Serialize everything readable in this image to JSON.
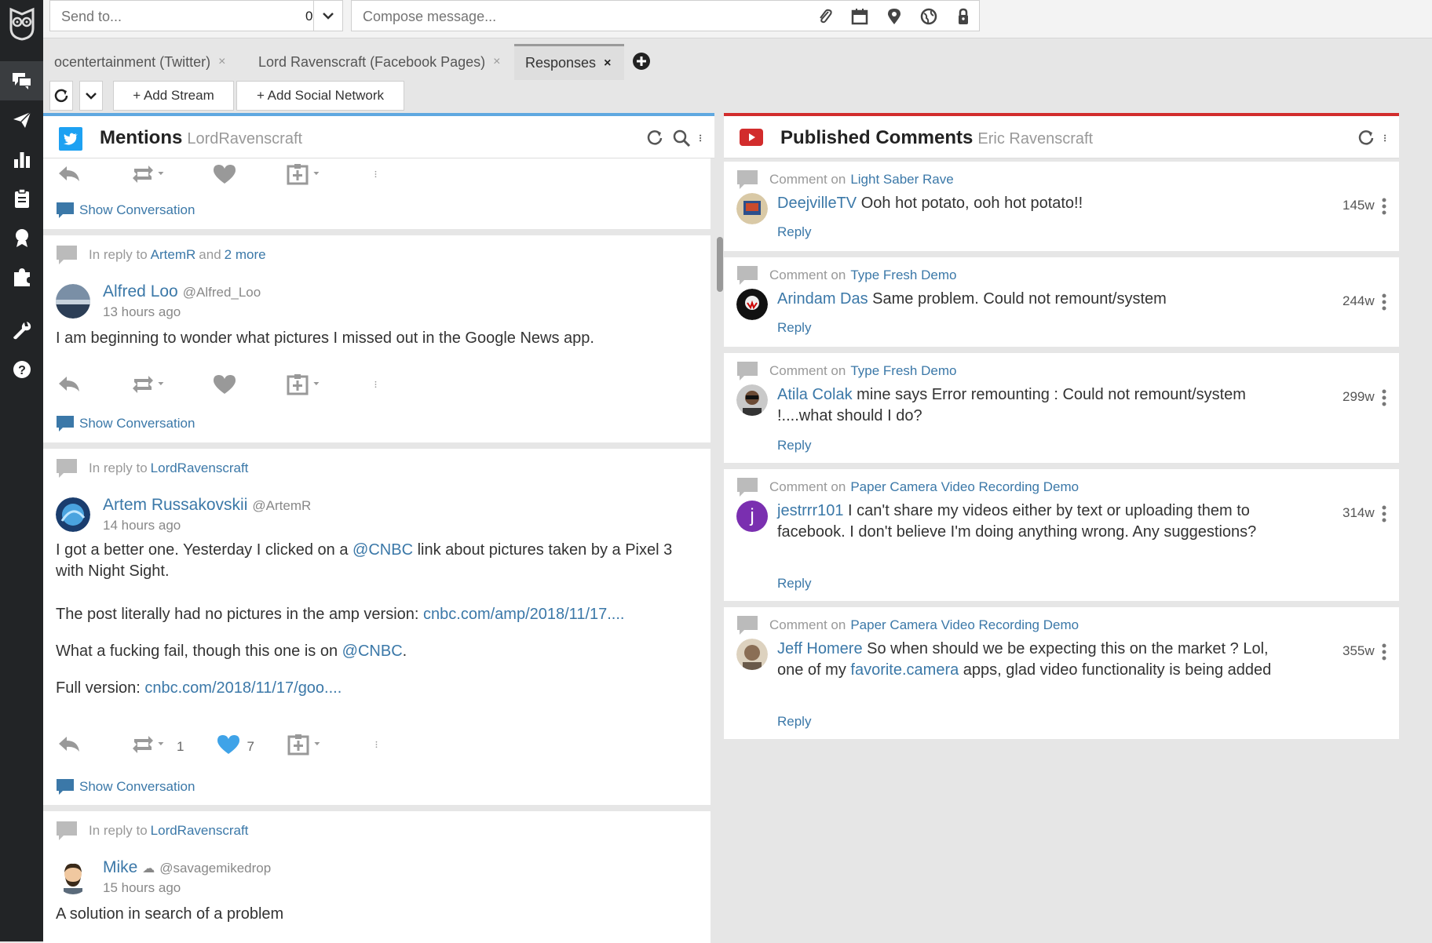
{
  "compose": {
    "send_to_placeholder": "Send to...",
    "send_to_count": "0",
    "message_placeholder": "Compose message..."
  },
  "tabs": [
    {
      "label": "ocentertainment (Twitter)",
      "close": "×"
    },
    {
      "label": "Lord Ravenscraft (Facebook Pages)",
      "close": "×"
    },
    {
      "label": "Responses",
      "close": "×"
    }
  ],
  "toolbar": {
    "add_stream": "+ Add Stream",
    "add_network": "+ Add Social Network"
  },
  "mentions": {
    "title": "Mentions",
    "account": "LordRavenscraft",
    "show_conversation": "Show Conversation",
    "posts": [
      {
        "reply_prefix": "In reply to",
        "reply_to": "ArtemR",
        "reply_and": "and",
        "reply_more": "2 more",
        "name": "Alfred Loo",
        "handle": "@Alfred_Loo",
        "time": "13 hours ago",
        "text": "I am beginning to wonder what pictures  I missed out in the Google News app."
      },
      {
        "reply_prefix": "In reply to",
        "reply_to": "LordRavenscraft",
        "name": "Artem Russakovskii",
        "handle": "@ArtemR",
        "time": "14 hours ago",
        "text1a": "I got a better one. Yesterday I clicked on a",
        "text1_link": "@CNBC",
        "text1b": "link about pictures taken by a Pixel 3 with Night Sight.",
        "text2a": "The post literally had no pictures in the amp version:",
        "text2_link": "cnbc.com/amp/2018/11/17....",
        "text3a": "What a fucking fail, though this one is on",
        "text3_link": "@CNBC",
        "text3b": ".",
        "text4a": "Full version:",
        "text4_link": "cnbc.com/2018/11/17/goo....",
        "retweets": "1",
        "likes": "7"
      },
      {
        "reply_prefix": "In reply to",
        "reply_to": "LordRavenscraft",
        "name": "Mike",
        "handle": "@savagemikedrop",
        "time": "15 hours ago",
        "text": "A solution in search of a problem"
      }
    ]
  },
  "comments": {
    "title": "Published Comments",
    "account": "Eric Ravenscraft",
    "comment_on": "Comment on",
    "reply_label": "Reply",
    "items": [
      {
        "video": "Light Saber Rave",
        "name": "DeejvilleTV",
        "text": "Ooh hot potato, ooh hot potato!!",
        "age": "145w"
      },
      {
        "video": "Type Fresh Demo",
        "name": "Arindam Das",
        "text": "Same problem. Could not remount/system",
        "age": "244w"
      },
      {
        "video": "Type Fresh Demo",
        "name": "Atila Colak",
        "text": "mine says Error remounting : Could not remount/system !....what should I do?",
        "age": "299w"
      },
      {
        "video": "Paper Camera Video Recording Demo",
        "name": "jestrrr101",
        "text": "I can't share my videos either by text or uploading them to facebook. I don't believe I'm doing anything wrong. Any suggestions?",
        "age": "314w",
        "avatar_letter": "j"
      },
      {
        "video": "Paper Camera Video Recording Demo",
        "name": "Jeff Homere",
        "text_a": "So when should we be expecting this on the market ? Lol, one of my",
        "text_link": "favorite.camera",
        "text_b": "apps, glad video functionality is being added",
        "age": "355w"
      }
    ]
  },
  "colors": {
    "sidebar_bg": "#222426",
    "twitter_blue": "#1da1f2",
    "youtube_red": "#d22c2c",
    "link": "#3b78a8",
    "like_active": "#3fa3e8"
  }
}
